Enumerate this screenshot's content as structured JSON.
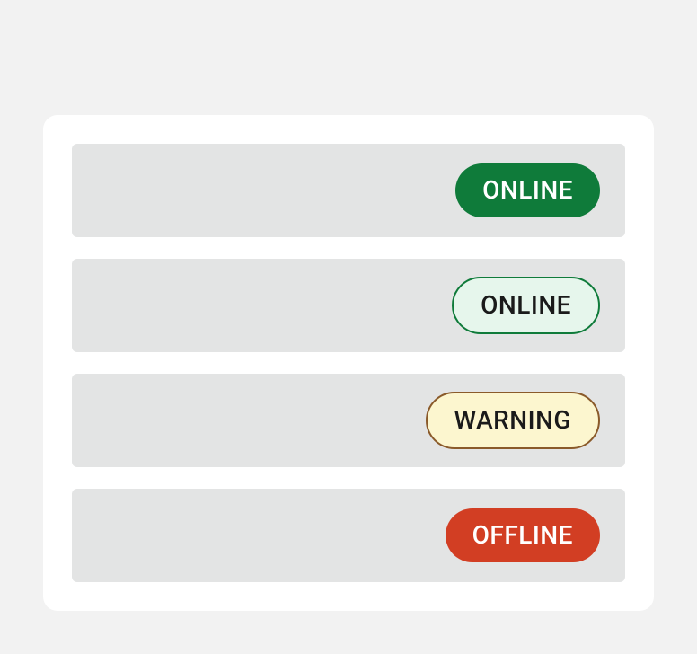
{
  "rows": [
    {
      "badge": {
        "label": "ONLINE",
        "variant": "solid-green"
      }
    },
    {
      "badge": {
        "label": "ONLINE",
        "variant": "outline-green"
      }
    },
    {
      "badge": {
        "label": "WARNING",
        "variant": "outline-warning"
      }
    },
    {
      "badge": {
        "label": "OFFLINE",
        "variant": "solid-red"
      }
    }
  ],
  "colors": {
    "solid_green": "#0f7b3a",
    "outline_green_bg": "#e6f6ec",
    "outline_warning_bg": "#fcf6cf",
    "outline_warning_border": "#8a5a2a",
    "solid_red": "#d23e23"
  }
}
